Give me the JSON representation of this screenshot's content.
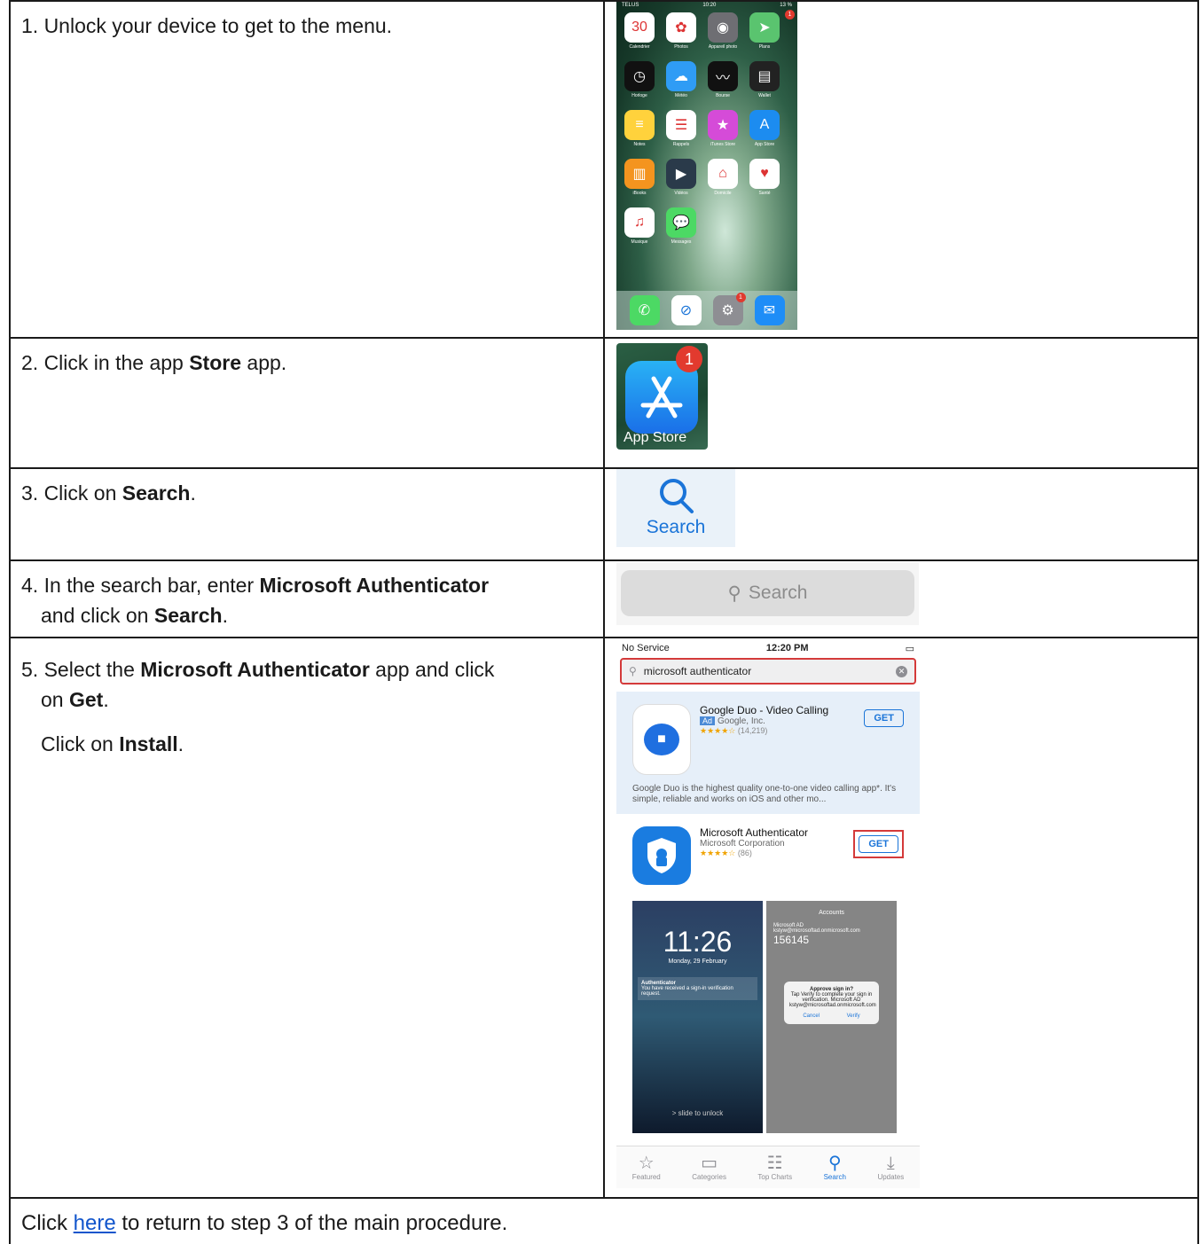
{
  "steps": {
    "s1": {
      "text": "1. Unlock your device to get to the menu."
    },
    "s2": {
      "pre": "2. Click in the app ",
      "bold": "Store",
      "post": " app."
    },
    "s3": {
      "pre": "3. Click on ",
      "bold": "Search",
      "post": "."
    },
    "s4": {
      "pre": "4. In the search bar, enter ",
      "bold1": "Microsoft Authenticator",
      "line2_pre": "and click on ",
      "bold2": "Search",
      "post": "."
    },
    "s5": {
      "pre": "5. Select the ",
      "bold1": "Microsoft Authenticator",
      "mid": " app and click",
      "line2_pre": "on ",
      "bold2": "Get",
      "post": ".",
      "line3_pre": "Click on ",
      "bold3": "Install",
      "line3_post": "."
    }
  },
  "footer": {
    "pre": "Click ",
    "link": "here",
    "post": " to return to step 3 of the main procedure."
  },
  "home_screen": {
    "carrier": "TELUS",
    "time": "10:20",
    "battery": "13 %",
    "apps": [
      {
        "label": "Calendrier",
        "icon": "calendar-icon",
        "color": "#ffffff",
        "glyph": "30"
      },
      {
        "label": "Photos",
        "icon": "photos-icon",
        "color": "#ffffff",
        "glyph": "✿"
      },
      {
        "label": "Appareil photo",
        "icon": "camera-icon",
        "color": "#6e6e73",
        "glyph": "◉"
      },
      {
        "label": "Plans",
        "icon": "maps-icon",
        "color": "#5ac46f",
        "glyph": "➤"
      },
      {
        "label": "Horloge",
        "icon": "clock-icon",
        "color": "#111111",
        "glyph": "◷"
      },
      {
        "label": "Météo",
        "icon": "weather-icon",
        "color": "#2f9cf5",
        "glyph": "☁"
      },
      {
        "label": "Bourse",
        "icon": "stocks-icon",
        "color": "#111111",
        "glyph": "〰"
      },
      {
        "label": "Wallet",
        "icon": "wallet-icon",
        "color": "#222222",
        "glyph": "▤"
      },
      {
        "label": "Notes",
        "icon": "notes-icon",
        "color": "#ffd23c",
        "glyph": "≡"
      },
      {
        "label": "Rappels",
        "icon": "reminders-icon",
        "color": "#ffffff",
        "glyph": "☰"
      },
      {
        "label": "iTunes Store",
        "icon": "itunes-store-icon",
        "color": "#d54bd8",
        "glyph": "★"
      },
      {
        "label": "App Store",
        "icon": "app-store-icon",
        "color": "#1c8cf0",
        "glyph": "A",
        "badge": "1"
      },
      {
        "label": "iBooks",
        "icon": "ibooks-icon",
        "color": "#f4941f",
        "glyph": "▥"
      },
      {
        "label": "Vidéos",
        "icon": "videos-icon",
        "color": "#2a3a4a",
        "glyph": "▶"
      },
      {
        "label": "Domicile",
        "icon": "home-app-icon",
        "color": "#ffffff",
        "glyph": "⌂"
      },
      {
        "label": "Santé",
        "icon": "health-icon",
        "color": "#ffffff",
        "glyph": "♥"
      },
      {
        "label": "Musique",
        "icon": "music-icon",
        "color": "#ffffff",
        "glyph": "♫"
      },
      {
        "label": "Messages",
        "icon": "messages-icon",
        "color": "#4cd964",
        "glyph": "💬"
      }
    ],
    "dock": [
      {
        "icon": "phone-icon",
        "color": "#4cd964",
        "glyph": "✆"
      },
      {
        "icon": "safari-icon",
        "color": "#ffffff",
        "glyph": "⊘"
      },
      {
        "icon": "settings-icon",
        "color": "#8e8e93",
        "glyph": "⚙",
        "badge": "1"
      },
      {
        "icon": "mail-icon",
        "color": "#1e8df7",
        "glyph": "✉"
      }
    ]
  },
  "app_store_tile": {
    "label": "App Store",
    "badge": "1"
  },
  "search_tile": {
    "label": "Search"
  },
  "search_bar": {
    "placeholder": "Search"
  },
  "phone": {
    "status": {
      "carrier": "No Service",
      "time": "12:20 PM"
    },
    "query": "microsoft authenticator",
    "results": [
      {
        "name": "Google Duo - Video Calling",
        "ad": "Ad",
        "dev": "Google, Inc.",
        "stars": "★★★★☆",
        "count": "(14,219)",
        "get": "GET",
        "desc": "Google Duo is the highest quality one-to-one video calling app*. It's simple, reliable and works on iOS and other mo..."
      },
      {
        "name": "Microsoft Authenticator",
        "dev": "Microsoft Corporation",
        "stars": "★★★★☆",
        "count": "(86)",
        "get": "GET"
      }
    ],
    "shot1": {
      "time": "11:26",
      "date": "Monday, 29 February",
      "notif_title": "Authenticator",
      "notif_body": "You have received a sign-in verification request.",
      "unlock": "> slide to unlock"
    },
    "shot2": {
      "header": "Accounts",
      "account": "Microsoft AD",
      "email": "kstyw@microsoftad.onmicrosoft.com",
      "code": "156145",
      "dialog_title": "Approve sign in?",
      "dialog_body": "Tap Verify to complete your sign in verification. Microsoft AD kstyw@microsoftad.onmicrosoft.com",
      "cancel": "Cancel",
      "verify": "Verify"
    },
    "tabs": [
      {
        "label": "Featured",
        "icon": "star-outline-icon",
        "glyph": "☆"
      },
      {
        "label": "Categories",
        "icon": "categories-icon",
        "glyph": "▭"
      },
      {
        "label": "Top Charts",
        "icon": "top-charts-icon",
        "glyph": "☷"
      },
      {
        "label": "Search",
        "icon": "search-icon",
        "glyph": "⚲",
        "active": true
      },
      {
        "label": "Updates",
        "icon": "updates-icon",
        "glyph": "⤓"
      }
    ]
  }
}
